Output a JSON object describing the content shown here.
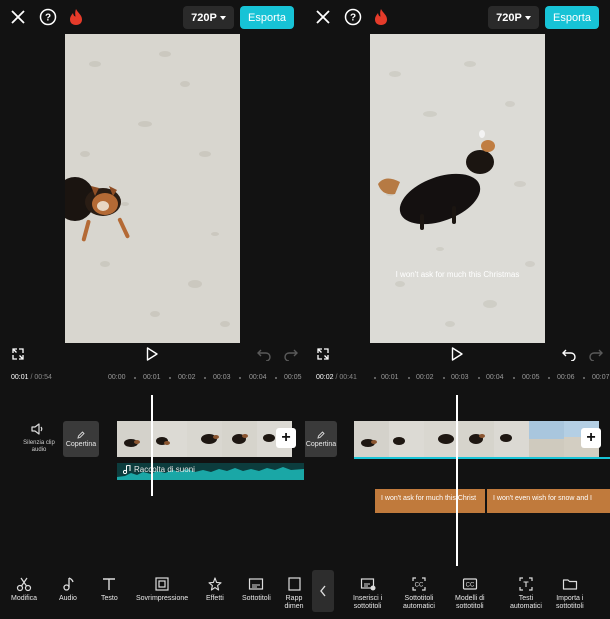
{
  "left": {
    "resolution_label": "720P",
    "export_label": "Esporta",
    "current_time": "00:01",
    "total_time": "/ 00:54",
    "ruler_ticks": [
      "00:00",
      "00:01",
      "00:02",
      "00:03",
      "00:04",
      "00:05"
    ],
    "mute_label": "Silenzia clip audio",
    "cover_label": "Copertina",
    "audio_label": "Raccolta di suoni",
    "tools": [
      "Modifica",
      "Audio",
      "Testo",
      "Sovrimpressione",
      "Effetti",
      "Sottotitoli",
      "Rapp dimen"
    ]
  },
  "right": {
    "resolution_label": "720P",
    "export_label": "Esporta",
    "current_time": "00:02",
    "total_time": "/ 00:41",
    "ruler_ticks": [
      "00:01",
      "00:02",
      "00:03",
      "00:04",
      "00:05",
      "00:06",
      "00:07"
    ],
    "cover_label": "Copertina",
    "subtitle_overlay": "I won't ask for much this Christmas",
    "subtitle_clips": [
      "I won't ask for much this Christ",
      "I won't even wish for snow and I"
    ],
    "tools": [
      {
        "line1": "Inserisci i",
        "line2": "sottotitoli"
      },
      {
        "line1": "Sottotitoli",
        "line2": "automatici"
      },
      {
        "line1": "Modelli di",
        "line2": "sottotitoli"
      },
      {
        "line1": "Testi",
        "line2": "automatici"
      },
      {
        "line1": "Importa i",
        "line2": "sottotitoli"
      }
    ]
  },
  "colors": {
    "accent": "#17c3d6",
    "background": "#121212",
    "flame": "#e53b2a",
    "subtitle_clip": "#c07a3c",
    "audio_track": "#0c3c3d",
    "waveform": "#1aa7a6"
  },
  "icons": [
    "close-icon",
    "help-icon",
    "flame-icon",
    "caret-down-icon",
    "fullscreen-icon",
    "play-icon",
    "undo-icon",
    "redo-icon",
    "speaker-icon",
    "pencil-icon",
    "plus-icon",
    "music-note-icon",
    "scissors-icon",
    "text-icon",
    "overlay-icon",
    "effects-icon",
    "subtitles-icon",
    "chevron-left-icon"
  ]
}
